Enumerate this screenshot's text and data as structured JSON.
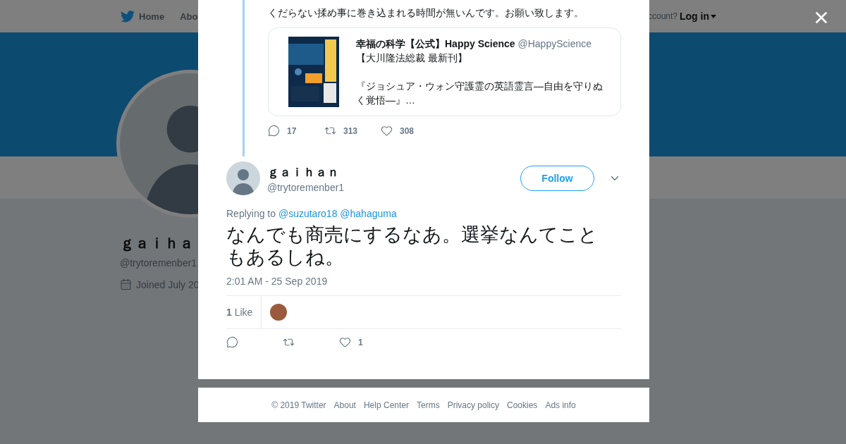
{
  "background_page": {
    "nav": {
      "home": "Home",
      "about": "Abo",
      "account_prompt": "ccount?",
      "login": "Log in"
    },
    "profile": {
      "name": "ｇａｉｈａ",
      "handle": "@trytoremenber1",
      "joined": "Joined July 20"
    }
  },
  "thread_tweet": {
    "text": "くだらない揉め事に巻き込まれる時間が無いんです。お願い致します。",
    "quoted": {
      "kind": "picture",
      "name": "幸福の科学【公式】Happy Science",
      "handle": "@HappyScience",
      "line_1": "【大川隆法総裁 最新刊】",
      "line_2": "『ジョシュア・ウォン守護霊の英語霊言―自由を守りぬく覚悟―』…"
    },
    "actions": [
      {
        "kind": "reply",
        "count": "17"
      },
      {
        "kind": "retweet",
        "count": "313"
      },
      {
        "kind": "like",
        "count": "308"
      }
    ]
  },
  "tweet": {
    "name": "ｇａｉｈａｎ",
    "handle": "@trytoremenber1",
    "follow": "Follow",
    "replying_to": "Replying to",
    "mentions": [
      "@suzutaro18",
      "@hahaguma"
    ],
    "text": "なんでも商売にするなあ。選挙なんてこともあるしね。",
    "time": "2:01 AM - 25 Sep 2019",
    "likes": "**1** Like",
    "actions": [
      {
        "kind": "reply"
      },
      {
        "kind": "retweet"
      },
      {
        "kind": "like",
        "count": "1"
      }
    ]
  },
  "footer": {
    "links": [
      "© 2019 Twitter",
      "About",
      "Help Center",
      "Terms",
      "Privacy policy",
      "Cookies",
      "Ads info"
    ]
  }
}
